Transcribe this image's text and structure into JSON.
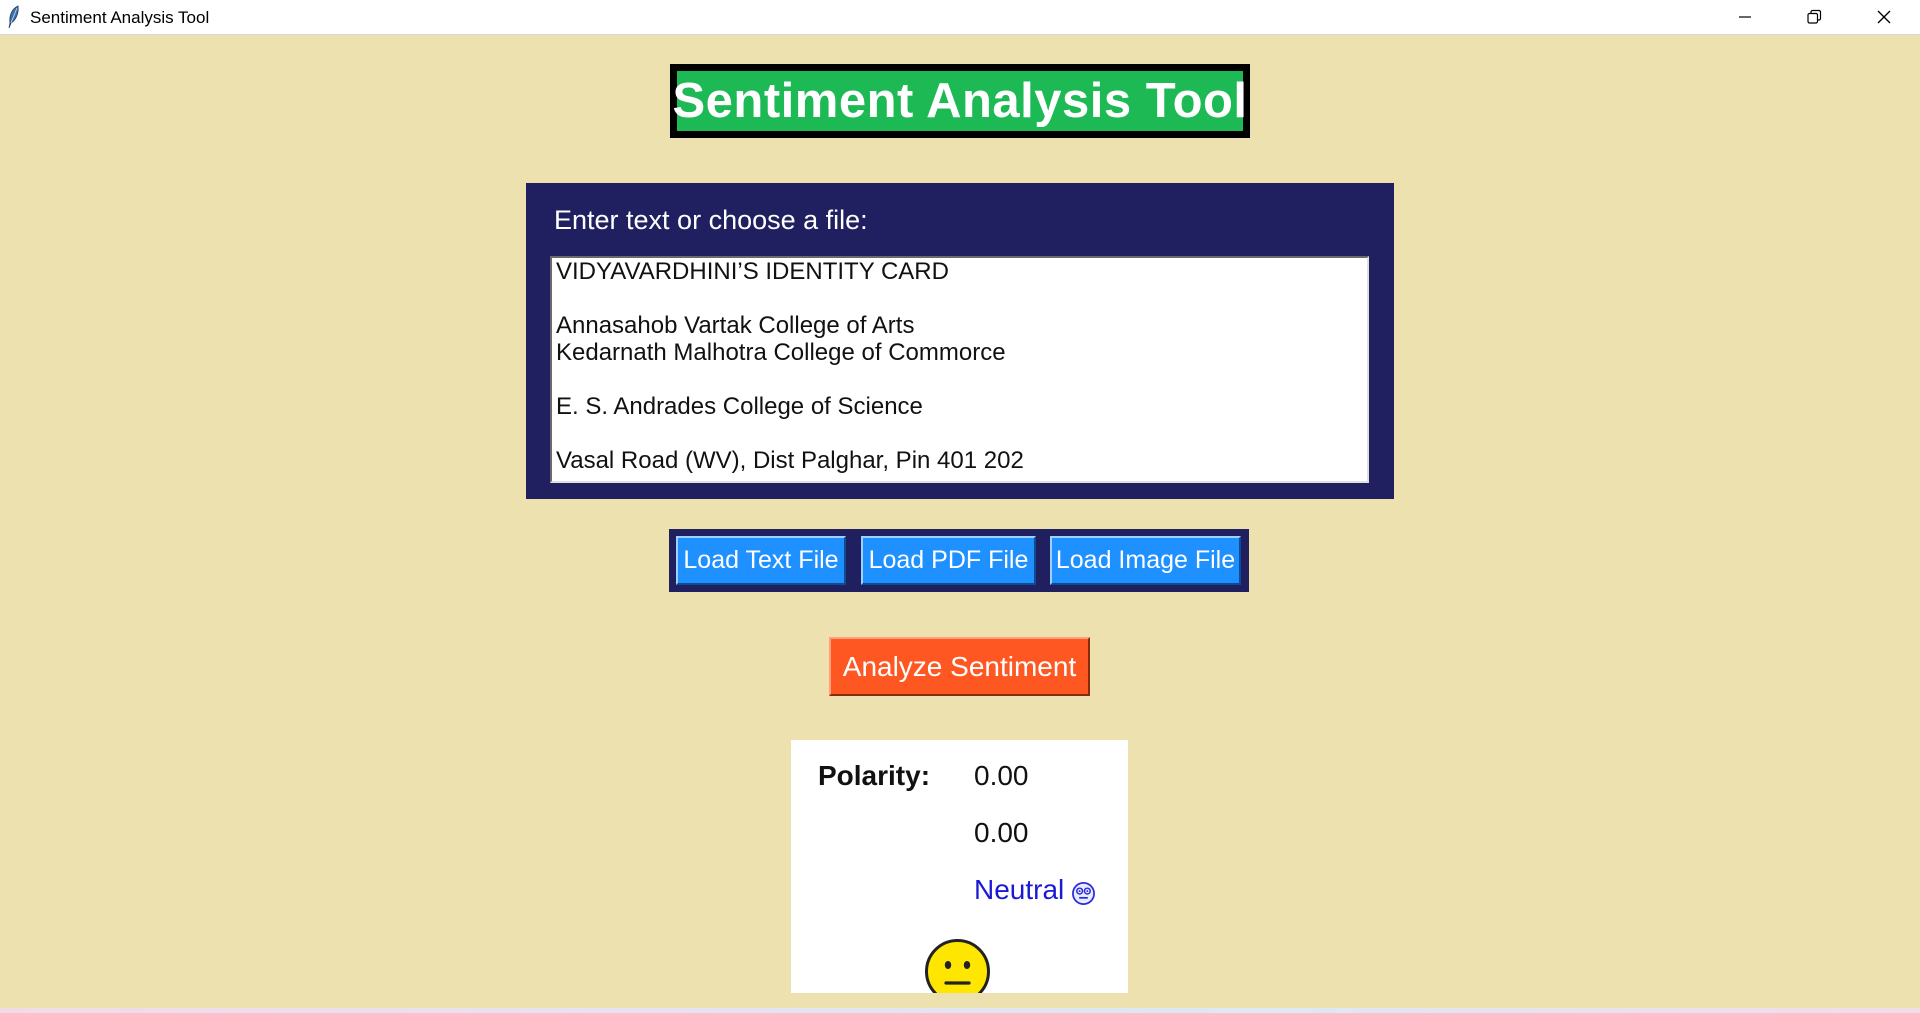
{
  "window": {
    "title": "Sentiment Analysis Tool",
    "icon": "feather-icon",
    "controls": [
      "minimize-icon",
      "restore-icon",
      "close-icon"
    ]
  },
  "header": {
    "title": "Sentiment Analysis Tool"
  },
  "input": {
    "label": "Enter text or choose a file:",
    "lines": [
      "VIDYAVARDHINI’S IDENTITY CARD",
      "",
      "Annasahob Vartak College of Arts",
      "Kedarnath Malhotra College of Commorce",
      "",
      "E. S. Andrades College of Science",
      "",
      "Vasal Road (WV), Dist Palghar, Pin 401 202"
    ]
  },
  "buttons": {
    "load_text": "Load Text File",
    "load_pdf": "Load PDF File",
    "load_image": "Load Image File",
    "analyze": "Analyze Sentiment"
  },
  "results": {
    "polarity_label": "Polarity:",
    "polarity_value": "0.00",
    "subjectivity_value": "0.00",
    "sentiment": "Neutral",
    "sentiment_icon": "neutral-face-icon"
  },
  "colors": {
    "background": "#eee1b0",
    "heading_bg": "#1db954",
    "panel_bg": "#202060",
    "load_button": "#1e90ff",
    "analyze_button": "#ff5722",
    "sentiment_text": "#1a1ad6",
    "face_yellow": "#ffe600"
  }
}
